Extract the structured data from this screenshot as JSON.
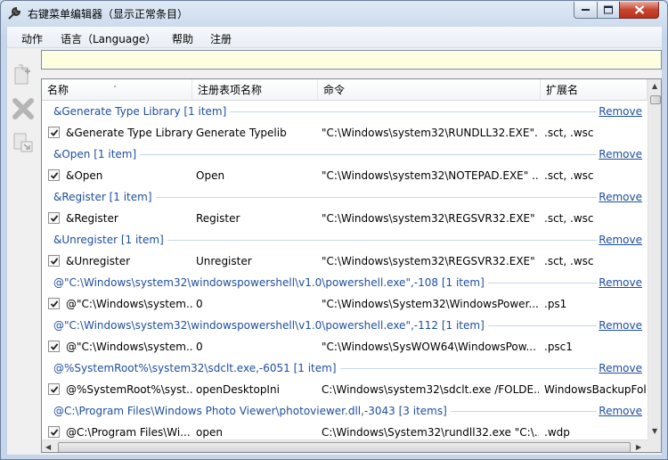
{
  "window": {
    "title": "右键菜单编辑器（显示正常条目）",
    "icons": {
      "app": "wrench-icon",
      "minimize": "minimize-icon",
      "maximize": "maximize-icon",
      "close": "close-icon"
    }
  },
  "menu": [
    "动作",
    "语言（Language）",
    "帮助",
    "注册"
  ],
  "toolbar": [
    "add-item-icon",
    "delete-icon",
    "export-icon"
  ],
  "pathbar": {
    "value": ""
  },
  "columns": [
    "名称",
    "注册表项名称",
    "命令",
    "扩展名"
  ],
  "remove_label": "Remove",
  "groups": [
    {
      "title": "&Generate Type Library [1 item]",
      "row": {
        "name": "&Generate Type Library",
        "reg": "Generate Typelib",
        "cmd": "\"C:\\Windows\\system32\\RUNDLL32.EXE\"...",
        "ext": ".sct, .wsc"
      }
    },
    {
      "title": "&Open [1 item]",
      "row": {
        "name": "&Open",
        "reg": "Open",
        "cmd": "\"C:\\Windows\\system32\\NOTEPAD.EXE\" ...",
        "ext": ".sct, .wsc"
      }
    },
    {
      "title": "&Register [1 item]",
      "row": {
        "name": "&Register",
        "reg": "Register",
        "cmd": "\"C:\\Windows\\system32\\REGSVR32.EXE\" ...",
        "ext": ".sct, .wsc"
      }
    },
    {
      "title": "&Unregister [1 item]",
      "row": {
        "name": "&Unregister",
        "reg": "Unregister",
        "cmd": "\"C:\\Windows\\system32\\REGSVR32.EXE\" ...",
        "ext": ".sct, .wsc"
      }
    },
    {
      "title": "@\"C:\\Windows\\system32\\windowspowershell\\v1.0\\powershell.exe\",-108 [1 item]",
      "row": {
        "name": "@\"C:\\Windows\\system...",
        "reg": "0",
        "cmd": "\"C:\\Windows\\System32\\WindowsPower...",
        "ext": ".ps1"
      }
    },
    {
      "title": "@\"C:\\Windows\\system32\\windowspowershell\\v1.0\\powershell.exe\",-112 [1 item]",
      "row": {
        "name": "@\"C:\\Windows\\system...",
        "reg": "0",
        "cmd": "\"C:\\Windows\\SysWOW64\\WindowsPow...",
        "ext": ".psc1"
      }
    },
    {
      "title": "@%SystemRoot%\\system32\\sdclt.exe,-6051 [1 item]",
      "row": {
        "name": "@%SystemRoot%\\syst...",
        "reg": "openDesktopIni",
        "cmd": "C:\\Windows\\system32\\sdclt.exe /FOLDE...",
        "ext": "WindowsBackupFol"
      }
    },
    {
      "title": "@C:\\Program Files\\Windows Photo Viewer\\photoviewer.dll,-3043 [3 items]",
      "row": {
        "name": "@C:\\Program Files\\Wi...",
        "reg": "open",
        "cmd": "C:\\Windows\\System32\\rundll32.exe \"C:\\...",
        "ext": ".wdp"
      }
    }
  ]
}
